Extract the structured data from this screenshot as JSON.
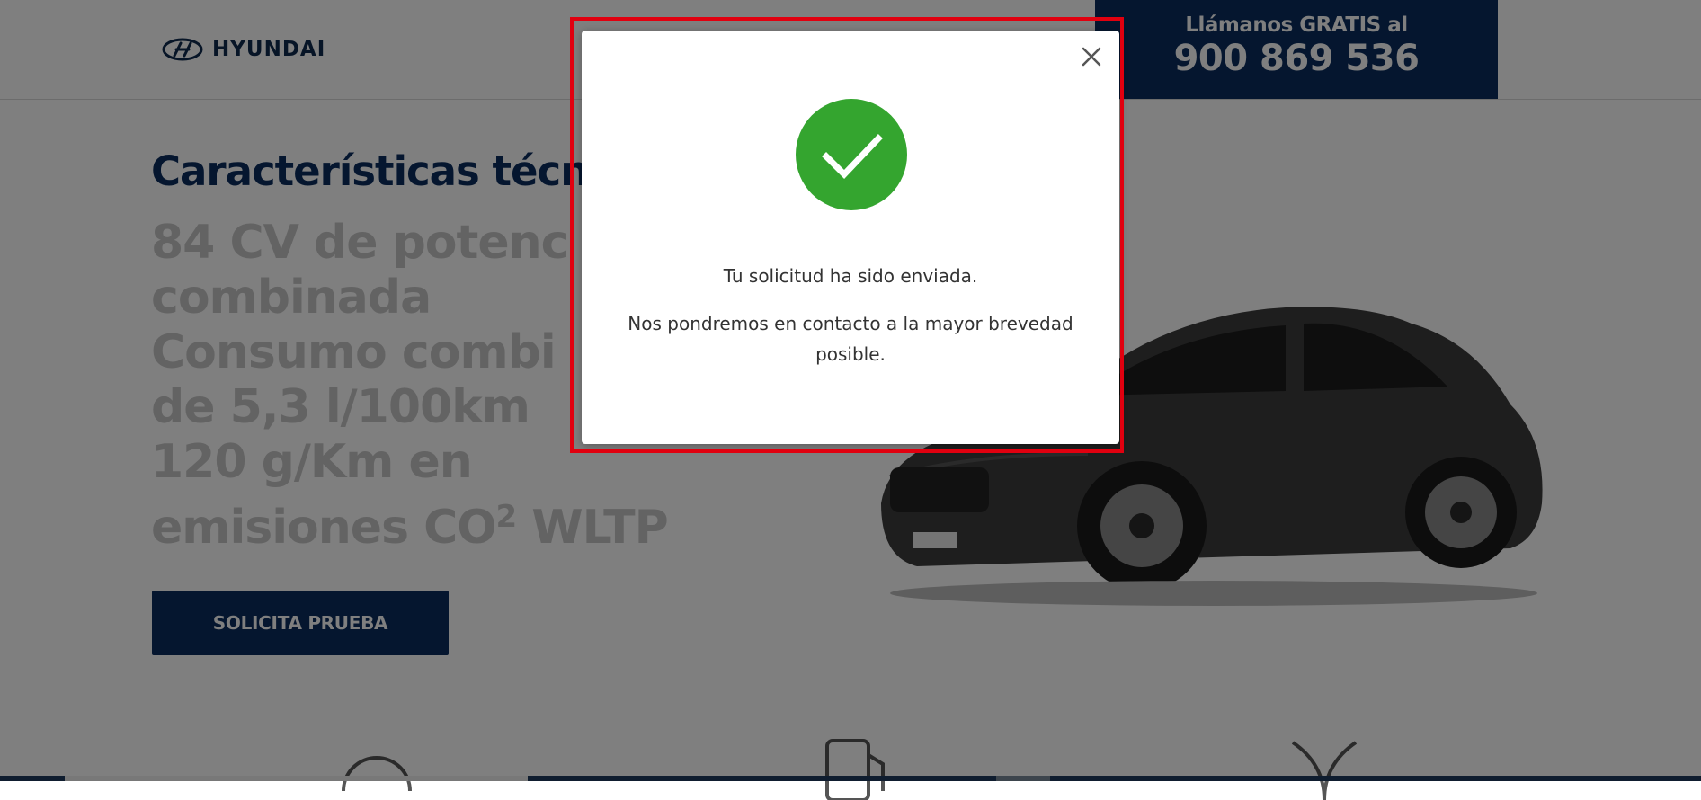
{
  "header": {
    "brand_name": "HYUNDAI",
    "call_label": "Llámanos GRATIS al",
    "call_number": "900 869 536"
  },
  "main": {
    "title": "Características técn",
    "specs": [
      "84 CV de potenc",
      "combinada",
      "Consumo combi",
      "de 5,3 l/100km",
      "120 g/Km en",
      "emisiones CO",
      "2",
      "WLTP"
    ],
    "cta_label": "SOLICITA PRUEBA"
  },
  "modal": {
    "message_primary": "Tu solicitud ha sido enviada.",
    "message_secondary": "Nos pondremos en contacto a la mayor brevedad posible."
  },
  "icons": {
    "close": "close-icon",
    "success": "checkmark-icon",
    "logo": "hyundai-logo-icon",
    "feature_1": "speedometer-icon",
    "feature_2": "fuel-pump-icon",
    "feature_3": "leaf-icon"
  },
  "colors": {
    "brand_navy": "#0a2d5e",
    "success_green": "#34a52f",
    "highlight_red": "#e1000f",
    "overlay": "rgba(0,0,0,0.5)"
  }
}
